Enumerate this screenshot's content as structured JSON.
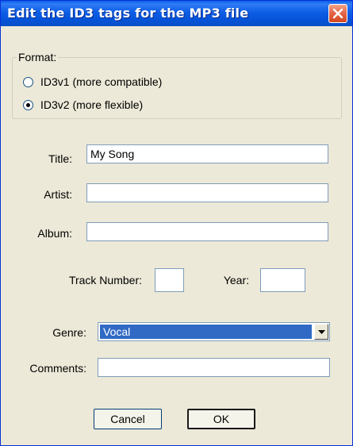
{
  "window": {
    "title": "Edit the ID3 tags for the MP3 file"
  },
  "format": {
    "legend": "Format:",
    "options": [
      {
        "label": "ID3v1 (more compatible)",
        "selected": false
      },
      {
        "label": "ID3v2 (more flexible)",
        "selected": true
      }
    ]
  },
  "fields": {
    "title_label": "Title:",
    "title_value": "My Song",
    "artist_label": "Artist:",
    "artist_value": "",
    "album_label": "Album:",
    "album_value": "",
    "track_label": "Track Number:",
    "track_value": "",
    "year_label": "Year:",
    "year_value": "",
    "genre_label": "Genre:",
    "genre_value": "Vocal",
    "comments_label": "Comments:",
    "comments_value": ""
  },
  "buttons": {
    "cancel": "Cancel",
    "ok": "OK"
  },
  "colors": {
    "titlebar": "#0553d8",
    "dialog_bg": "#ece9d8",
    "selection": "#316ac5",
    "close_button": "#d4471f"
  }
}
